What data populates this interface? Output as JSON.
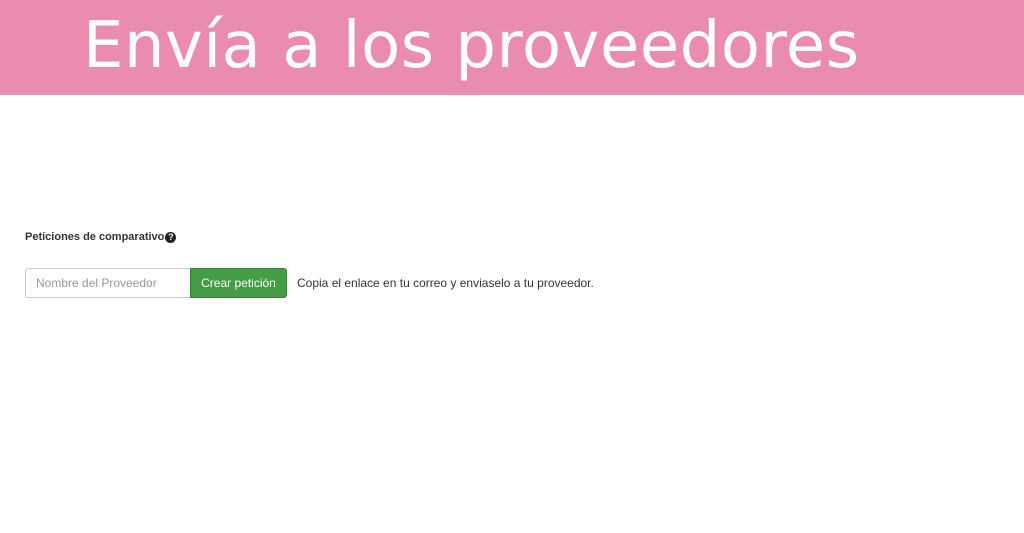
{
  "banner": {
    "title": "Envía a los proveedores",
    "background": "#ea8cb0"
  },
  "section": {
    "label": "Peticiones de comparativo",
    "help_icon": "question-circle-icon"
  },
  "form": {
    "supplier_placeholder": "Nombre del Proveedor",
    "supplier_value": "",
    "create_label": "Crear petición",
    "create_color": "#449d44",
    "hint": "Copia el enlace en tu correo y enviaselo a tu proveedor."
  }
}
